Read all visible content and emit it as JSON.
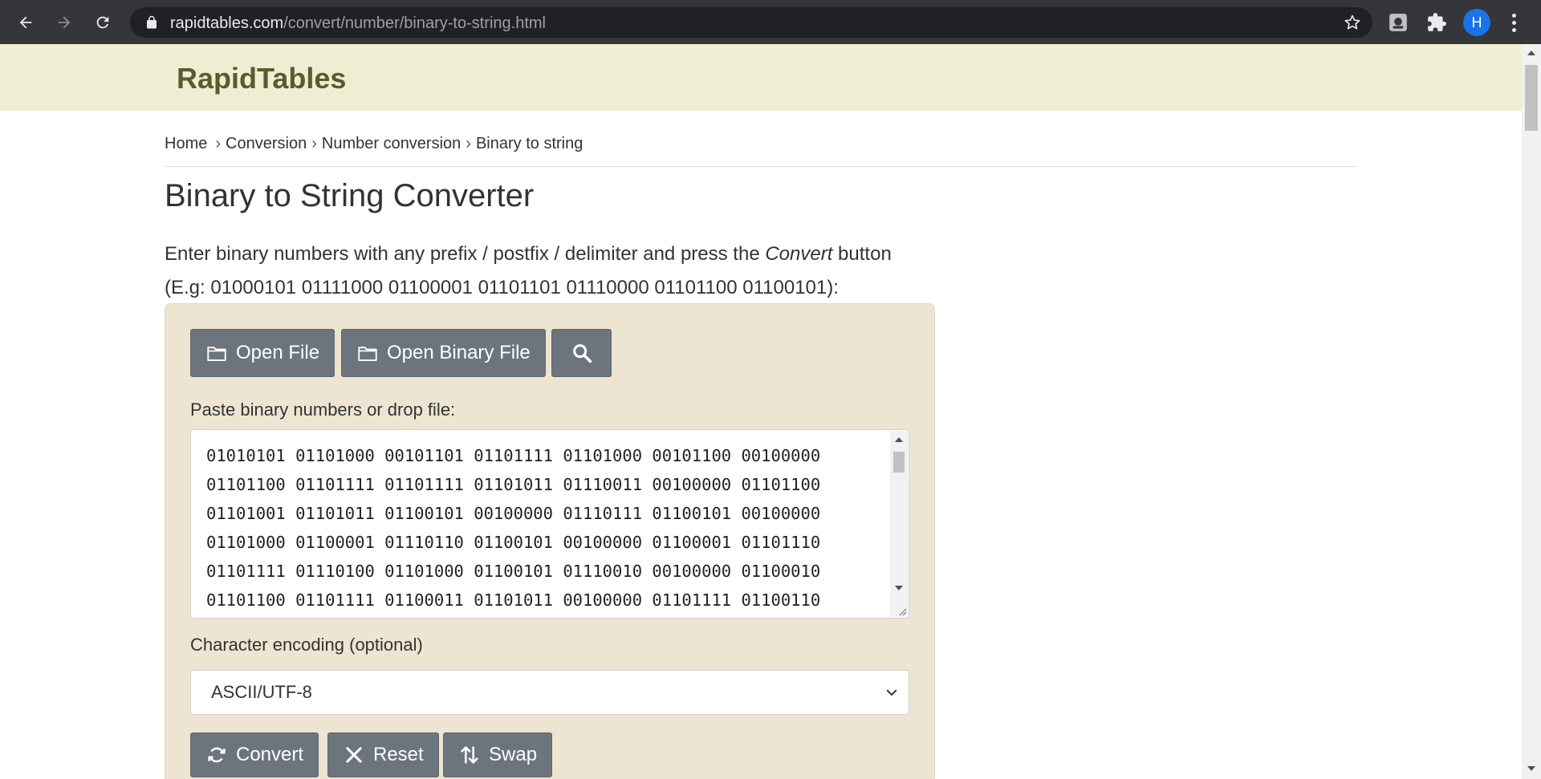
{
  "browser": {
    "url_host": "rapidtables.com",
    "url_path": "/convert/number/binary-to-string.html",
    "profile_initial": "H"
  },
  "site": {
    "logo": "RapidTables"
  },
  "breadcrumb": {
    "items": [
      "Home",
      "Conversion",
      "Number conversion",
      "Binary to string"
    ],
    "separator": "›"
  },
  "page": {
    "title": "Binary to String Converter",
    "intro_before": "Enter binary numbers with any prefix / postfix / delimiter and press the ",
    "intro_em": "Convert",
    "intro_after": " button",
    "intro_example": "(E.g: 01000101 01111000 01100001 01101101 01110000 01101100 01100101):"
  },
  "tool": {
    "open_file_label": "Open File",
    "open_binary_file_label": "Open Binary File",
    "input_label": "Paste binary numbers or drop file:",
    "input_lines": [
      "01010101 01101000 00101101 01101111 01101000 00101100 00100000",
      "01101100 01101111 01101111 01101011 01110011 00100000 01101100",
      "01101001 01101011 01100101 00100000 01110111 01100101 00100000",
      "01101000 01100001 01110110 01100101 00100000 01100001 01101110",
      "01101111 01110100 01101000 01100101 01110010 00100000 01100010",
      "01101100 01101111 01100011 01101011 00100000 01101111 01100110"
    ],
    "encoding_label": "Character encoding (optional)",
    "encoding_value": "ASCII/UTF-8",
    "convert_label": "Convert",
    "reset_label": "Reset",
    "swap_label": "Swap"
  },
  "icons": {
    "back": "back-arrow-icon",
    "forward": "forward-arrow-icon",
    "reload": "reload-icon",
    "lock": "lock-icon",
    "star": "star-icon",
    "extension": "puzzle-icon",
    "folder": "folder-icon",
    "search": "search-icon",
    "convert": "refresh-icon",
    "reset": "close-icon",
    "swap": "swap-icon"
  },
  "colors": {
    "chrome_bg": "#35363a",
    "header_bg": "#f0eed2",
    "logo": "#5a5b2e",
    "panel_bg": "#ede5d2",
    "button_bg": "#6c757d"
  }
}
